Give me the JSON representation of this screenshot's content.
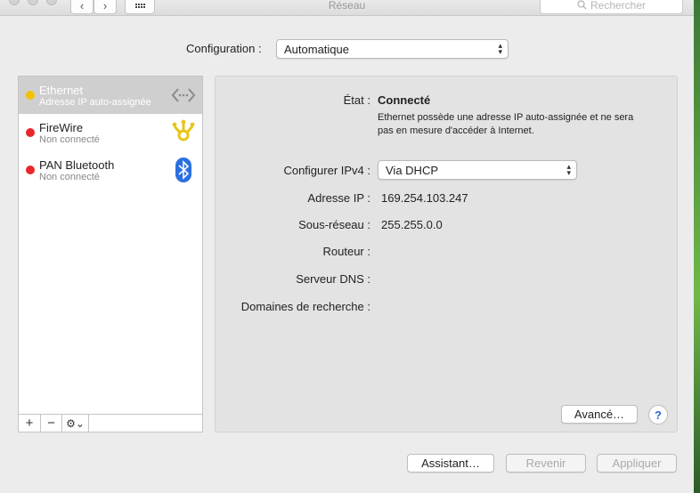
{
  "window": {
    "title": "Réseau",
    "search_placeholder": "Rechercher",
    "nav_back": "‹",
    "nav_forward": "›"
  },
  "configuration": {
    "label": "Configuration :",
    "value": "Automatique"
  },
  "services": [
    {
      "name": "Ethernet",
      "status": "Adresse IP auto-assignée",
      "dot_color": "#f2c200",
      "icon": "ethernet-icon",
      "selected": true
    },
    {
      "name": "FireWire",
      "status": "Non connecté",
      "dot_color": "#e8282a",
      "icon": "firewire-icon",
      "selected": false
    },
    {
      "name": "PAN Bluetooth",
      "status": "Non connecté",
      "dot_color": "#e8282a",
      "icon": "bluetooth-icon",
      "selected": false
    }
  ],
  "sidebar_tools": {
    "add": "+",
    "remove": "−",
    "actions": "⚙︎⌄"
  },
  "detail": {
    "etat_label": "État :",
    "etat_value": "Connecté",
    "description": "Ethernet possède une adresse IP auto-assignée et ne sera pas en mesure d'accéder à Internet.",
    "ipv4_label": "Configurer IPv4 :",
    "ipv4_value": "Via DHCP",
    "ip_label": "Adresse IP :",
    "ip_value": "169.254.103.247",
    "subnet_label": "Sous-réseau :",
    "subnet_value": "255.255.0.0",
    "router_label": "Routeur :",
    "dns_label": "Serveur DNS :",
    "domains_label": "Domaines de recherche :",
    "advanced_button": "Avancé…",
    "help_button": "?"
  },
  "footer": {
    "assistant": "Assistant…",
    "revert": "Revenir",
    "apply": "Appliquer"
  },
  "colors": {
    "accent_blue": "#2a6ad8",
    "status_yellow": "#f2c200",
    "status_red": "#e8282a",
    "bluetooth_blue": "#2b6fe0",
    "firewire_yellow": "#e9c51a"
  }
}
